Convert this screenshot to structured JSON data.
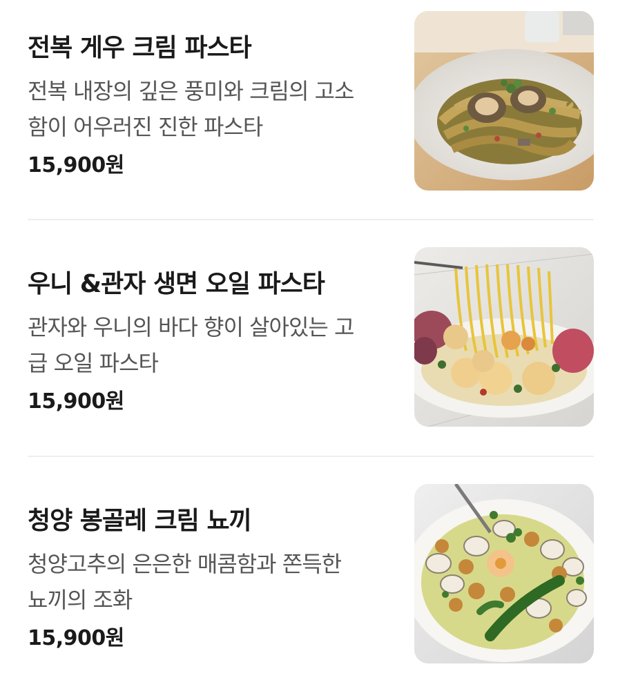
{
  "menu": {
    "items": [
      {
        "title": "전복 게우 크림 파스타",
        "desc_lines": [
          "전복 내장의 깊은 풍미와 크림의 고소",
          "함이 어우러진 진한 파스타"
        ],
        "price": "15,900원"
      },
      {
        "title": "우니 &관자 생면 오일 파스타",
        "desc_lines": [
          "관자와 우니의 바다 향이 살아있는 고",
          "급 오일 파스타"
        ],
        "price": "15,900원"
      },
      {
        "title": "청양 봉골레 크림 뇨끼",
        "desc_lines": [
          "청양고추의 은은한 매콤함과 쫀득한",
          "뇨끼의 조화"
        ],
        "price": "15,900원"
      }
    ]
  }
}
